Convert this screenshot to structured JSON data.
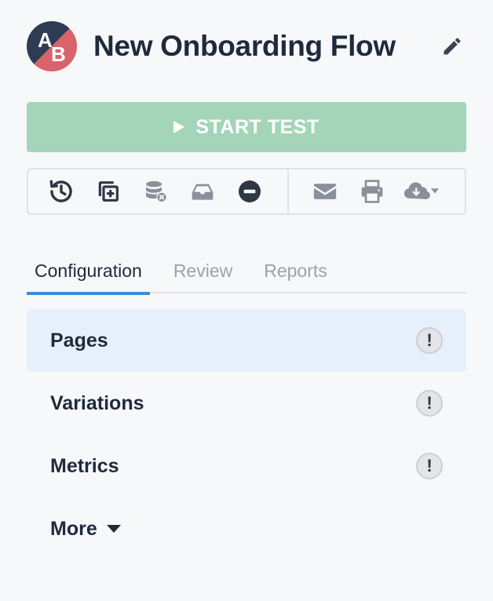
{
  "header": {
    "avatar": {
      "letter_a": "A",
      "letter_b": "B",
      "colors": {
        "top_left": "#2f3b52",
        "bottom_right": "#d9636a"
      }
    },
    "title": "New Onboarding Flow",
    "edit_icon": "pencil-icon"
  },
  "start_button": {
    "label": "START TEST",
    "icon": "play-icon",
    "color": "#a4d5b8"
  },
  "toolbar": {
    "left_group": [
      "history-icon",
      "duplicate-icon",
      "archive-database-icon",
      "inbox-icon",
      "minus-circle-icon"
    ],
    "right_group": [
      "envelope-icon",
      "print-icon",
      "cloud-download-icon"
    ]
  },
  "tabs": [
    {
      "label": "Configuration",
      "active": true
    },
    {
      "label": "Review",
      "active": false
    },
    {
      "label": "Reports",
      "active": false
    }
  ],
  "accent_color": "#3b8ddd",
  "nav": {
    "items": [
      {
        "label": "Pages",
        "badge": "!",
        "active": true
      },
      {
        "label": "Variations",
        "badge": "!",
        "active": false
      },
      {
        "label": "Metrics",
        "badge": "!",
        "active": false
      }
    ],
    "more_label": "More"
  }
}
